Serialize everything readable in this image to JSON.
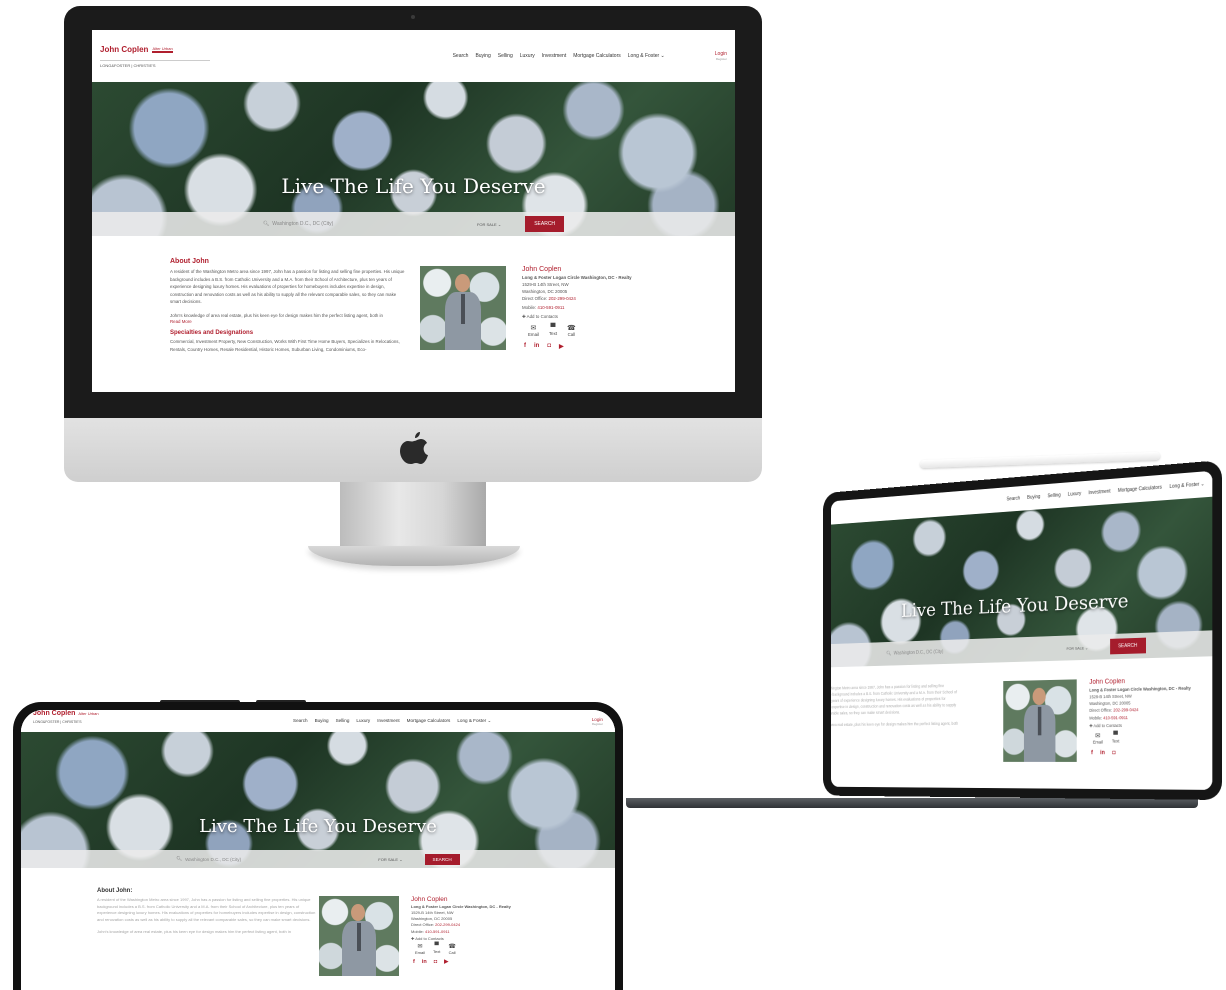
{
  "site": {
    "logo": {
      "name": "John Coplen",
      "sub": "Alter Urban",
      "brands": "LONG&FOSTER | CHRISTIE'S"
    },
    "nav": [
      "Search",
      "Buying",
      "Selling",
      "Luxury",
      "Investment",
      "Mortgage Calculators",
      "Long & Foster"
    ],
    "login": "Login",
    "register": "Register",
    "hero_title": "Live The Life You Deserve",
    "search_placeholder": "Washington D.C., DC (City)",
    "for_sale": "FOR SALE",
    "search_button": "SEARCH",
    "about_heading": "About John",
    "about_heading_phone": "About John:",
    "about_p1": "A resident of the Washington Metro area since 1997, John has a passion for listing and selling fine properties. His unique background includes a B.S. from Catholic University and a M.A. from their School of Architecture, plus ten years of experience designing luxury homes. His evaluations of properties for homebuyers includes expertise in design, construction and renovation costs as well as his ability to supply all the relevant comparable sales, so they can make smart decisions.",
    "about_p2": "John's knowledge of area real estate, plus his keen eye for design makes him the perfect listing agent, both in",
    "read_more": "Read More",
    "spec_heading": "Specialties and Designations",
    "spec_text": "Commercial, Investment Property, New Construction, Works With First Time Home Buyers, Specializes in Relocations, Rentals, Country Homes, Resale Residential, Historic Homes, Suburban Living, Condominiums, Eco-",
    "agent": {
      "name": "John Coplen",
      "office": "Long & Foster Logan Circle Washington, DC - Realty",
      "street": "1529-B 14th Street, NW",
      "city": "Washington, DC 20005",
      "direct_label": "Direct Office:",
      "direct": "202-299-0424",
      "mobile_label": "Mobile:",
      "mobile": "410-591-0911",
      "add": "Add to Contacts",
      "email": "Email",
      "text": "Text",
      "call": "Call"
    }
  },
  "colors": {
    "accent": "#b01f2e",
    "button": "#a51c2c"
  },
  "icons": [
    "search-icon",
    "email-icon",
    "text-icon",
    "call-icon",
    "facebook-icon",
    "linkedin-icon",
    "instagram-icon",
    "youtube-icon",
    "apple-logo-icon"
  ]
}
